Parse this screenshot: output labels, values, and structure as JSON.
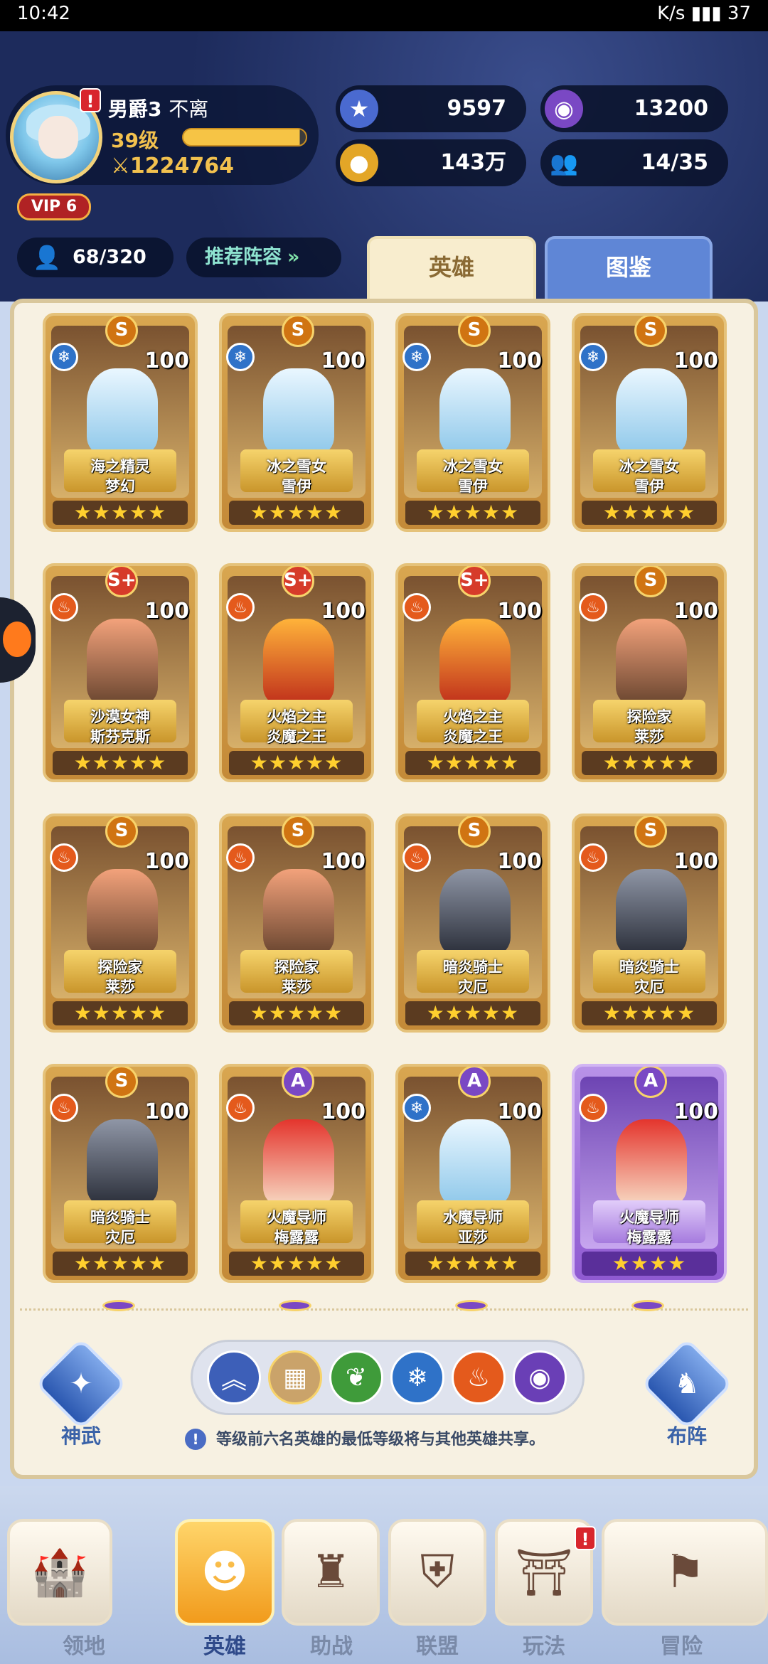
{
  "status_bar": {
    "time": "10:42",
    "right": "K/s  ▮▮▮  37"
  },
  "player": {
    "title": "男爵3",
    "name": "不离",
    "level": "39级",
    "power": "1224764",
    "vip": "VIP 6",
    "xp_fraction": 0.95
  },
  "resources": {
    "star_gems": "9597",
    "purple_orbs": "13200",
    "gold": "143万",
    "friends": "14/35"
  },
  "hero_count": "68/320",
  "recommend_label": "推荐阵容",
  "tabs": [
    {
      "label": "英雄",
      "active": true
    },
    {
      "label": "图鉴",
      "active": false
    }
  ],
  "heroes": [
    {
      "grade": "S",
      "element": "ice",
      "level": "100",
      "title": "海之精灵",
      "name": "梦幻",
      "stars": 5
    },
    {
      "grade": "S",
      "element": "ice",
      "level": "100",
      "title": "冰之雪女",
      "name": "雪伊",
      "stars": 5
    },
    {
      "grade": "S",
      "element": "ice",
      "level": "100",
      "title": "冰之雪女",
      "name": "雪伊",
      "stars": 5
    },
    {
      "grade": "S",
      "element": "ice",
      "level": "100",
      "title": "冰之雪女",
      "name": "雪伊",
      "stars": 5
    },
    {
      "grade": "S+",
      "element": "fire",
      "level": "100",
      "title": "沙漠女神",
      "name": "斯芬克斯",
      "stars": 5
    },
    {
      "grade": "S+",
      "element": "fire",
      "level": "100",
      "title": "火焰之主",
      "name": "炎魔之王",
      "stars": 5
    },
    {
      "grade": "S+",
      "element": "fire",
      "level": "100",
      "title": "火焰之主",
      "name": "炎魔之王",
      "stars": 5
    },
    {
      "grade": "S",
      "element": "fire",
      "level": "100",
      "title": "探险家",
      "name": "莱莎",
      "stars": 5
    },
    {
      "grade": "S",
      "element": "fire",
      "level": "100",
      "title": "探险家",
      "name": "莱莎",
      "stars": 5
    },
    {
      "grade": "S",
      "element": "fire",
      "level": "100",
      "title": "探险家",
      "name": "莱莎",
      "stars": 5
    },
    {
      "grade": "S",
      "element": "fire",
      "level": "100",
      "title": "暗炎骑士",
      "name": "灾厄",
      "stars": 5
    },
    {
      "grade": "S",
      "element": "fire",
      "level": "100",
      "title": "暗炎骑士",
      "name": "灾厄",
      "stars": 5
    },
    {
      "grade": "S",
      "element": "fire",
      "level": "100",
      "title": "暗炎骑士",
      "name": "灾厄",
      "stars": 5
    },
    {
      "grade": "A",
      "element": "fire",
      "level": "100",
      "title": "火魔导师",
      "name": "梅露露",
      "stars": 5
    },
    {
      "grade": "A",
      "element": "ice",
      "level": "100",
      "title": "水魔导师",
      "name": "亚莎",
      "stars": 5
    },
    {
      "grade": "A",
      "element": "fire",
      "level": "100",
      "title": "火魔导师",
      "name": "梅露露",
      "stars": 4
    }
  ],
  "side_buttons": {
    "left": "神武",
    "right": "布阵"
  },
  "filter_icons": [
    "chevrons-up-icon",
    "grid-icon",
    "leaf-icon",
    "snowflake-icon",
    "flame-icon",
    "eye-icon"
  ],
  "notice": "等级前六名英雄的最低等级将与其他英雄共享。",
  "bottom_nav": [
    {
      "label": "领地",
      "icon": "castle-icon",
      "active": false
    },
    {
      "label": "英雄",
      "icon": "hero-icon",
      "active": true
    },
    {
      "label": "助战",
      "icon": "helmet-icon",
      "active": false
    },
    {
      "label": "联盟",
      "icon": "shield-icon",
      "active": false
    },
    {
      "label": "玩法",
      "icon": "gate-icon",
      "active": false,
      "badge": "!"
    },
    {
      "label": "冒险",
      "icon": "flag-icon",
      "active": false
    }
  ]
}
